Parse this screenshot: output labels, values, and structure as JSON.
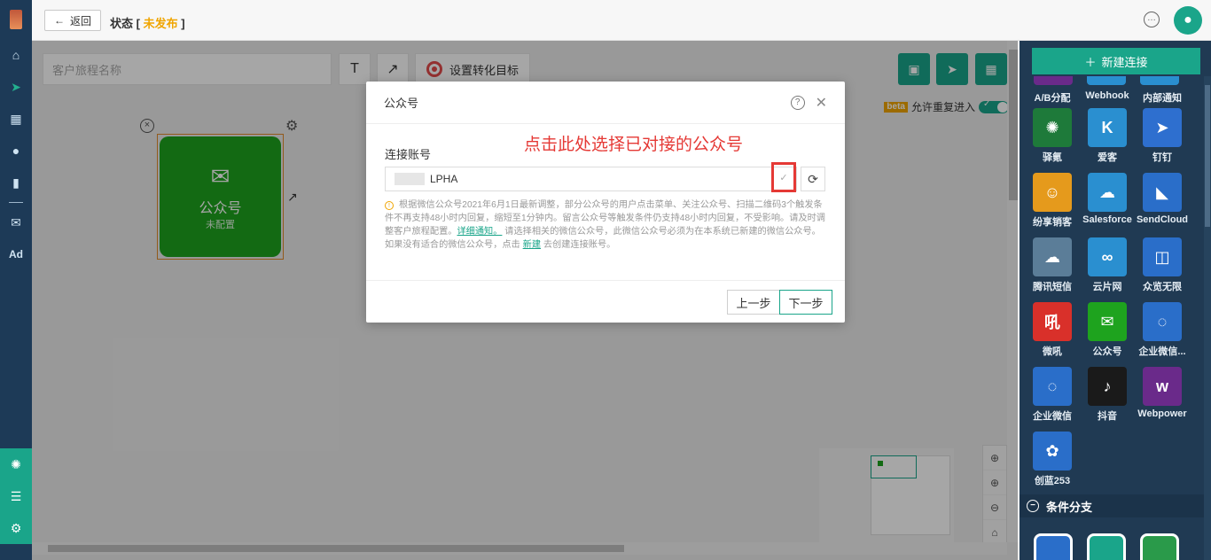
{
  "topbar": {
    "back_label": "返回",
    "status_label": "状态",
    "status_value": "未发布"
  },
  "canvas": {
    "journey_name_placeholder": "客户旅程名称",
    "text_tool": "T",
    "arrow_tool": "↗",
    "goal_label": "设置转化目标",
    "beta_tag": "beta",
    "allow_reentry_label": "允许重复进入",
    "node": {
      "title": "公众号",
      "subtitle": "未配置"
    }
  },
  "right_panel": {
    "new_connection_label": "新建连接",
    "top_labels": [
      "A/B分配",
      "Webhook",
      "内部通知"
    ],
    "tiles": [
      {
        "label": "驿氪",
        "color": "#1e7a3a",
        "icon": "spider-icon",
        "glyph": "✺"
      },
      {
        "label": "爱客",
        "color": "#2a8fd0",
        "icon": "k-hex-icon",
        "glyph": "K"
      },
      {
        "label": "钉钉",
        "color": "#2e6fcf",
        "icon": "dingtalk-icon",
        "glyph": "➤"
      },
      {
        "label": "纷享销客",
        "color": "#e59a1c",
        "icon": "robot-icon",
        "glyph": "☺"
      },
      {
        "label": "Salesforce",
        "color": "#2a8fd0",
        "icon": "cloud-icon",
        "glyph": "☁"
      },
      {
        "label": "SendCloud",
        "color": "#2a6ec9",
        "icon": "sendcloud-icon",
        "glyph": "◣"
      },
      {
        "label": "腾讯短信",
        "color": "#5b7d98",
        "icon": "tencent-cloud-icon",
        "glyph": "☁"
      },
      {
        "label": "云片网",
        "color": "#2a8fd0",
        "icon": "yunpian-icon",
        "glyph": "∞"
      },
      {
        "label": "众览无限",
        "color": "#2a6ec9",
        "icon": "zhonglan-icon",
        "glyph": "◫"
      },
      {
        "label": "微吼",
        "color": "#d9302a",
        "icon": "vhall-icon",
        "glyph": "吼"
      },
      {
        "label": "公众号",
        "color": "#1ea31e",
        "icon": "wechat-icon",
        "glyph": "✉"
      },
      {
        "label": "企业微信...",
        "color": "#2a6ec9",
        "icon": "wecom-icon",
        "glyph": "◌"
      },
      {
        "label": "企业微信",
        "color": "#2a6ec9",
        "icon": "wecom-chat-icon",
        "glyph": "◌"
      },
      {
        "label": "抖音",
        "color": "#1a1a1a",
        "icon": "douyin-icon",
        "glyph": "♪"
      },
      {
        "label": "Webpower",
        "color": "#6a2a8a",
        "icon": "webpower-icon",
        "glyph": "w"
      },
      {
        "label": "创蓝253",
        "color": "#2a6ec9",
        "icon": "chuanglan-icon",
        "glyph": "✿"
      }
    ],
    "condition_branch_label": "条件分支"
  },
  "dialog": {
    "title": "公众号",
    "field_label": "连接账号",
    "annotation": "点击此处选择已对接的公众号",
    "selected_account": "LPHA",
    "notice_part1": "根据微信公众号2021年6月1日最新调整，部分公众号的用户点击菜单、关注公众号、扫描二维码3个触发条件不再支持48小时内回复，缩短至1分钟内。留言公众号等触发条件仍支持48小时内回复，不受影响。请及时调整客户旅程配置。",
    "notice_link1": "详细通知。",
    "notice_part2": "请选择相关的微信公众号，此微信公众号必须为在本系统已新建的微信公众号。如果没有适合的微信公众号，点击",
    "notice_link2": "新建",
    "notice_part3": "去创建连接账号。",
    "prev_label": "上一步",
    "next_label": "下一步"
  }
}
